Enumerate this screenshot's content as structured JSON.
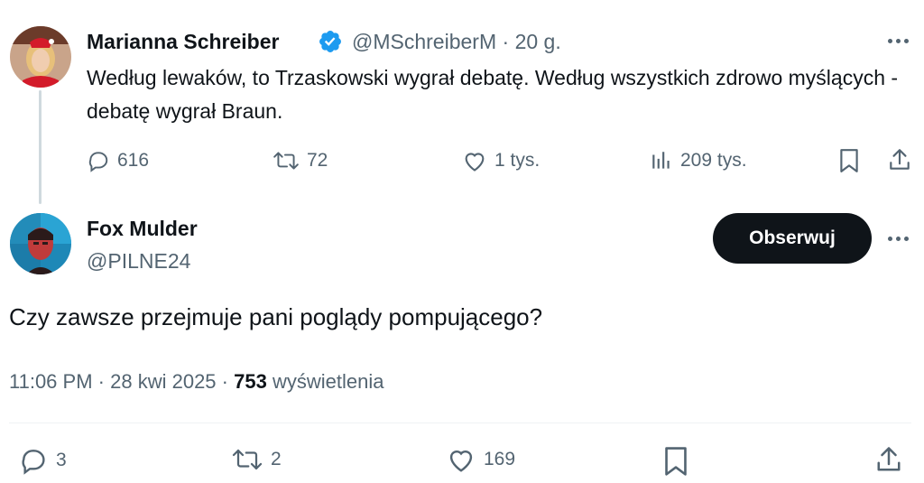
{
  "parent_tweet": {
    "author_name": "Marianna Schreiber",
    "verified": true,
    "handle": "@MSchreiberM",
    "separator": "·",
    "time": "20 g.",
    "text": "Według lewaków, to Trzaskowski wygrał debatę. Według wszystkich zdrowo myślących - debatę wygrał Braun.",
    "replies": "616",
    "retweets": "72",
    "likes": "1 tys.",
    "views": "209 tys."
  },
  "reply_tweet": {
    "author_name": "Fox Mulder",
    "handle": "@PILNE24",
    "follow_label": "Obserwuj",
    "text": "Czy zawsze przejmuje pani poglądy pompującego?",
    "time": "11:06 PM",
    "separator": "·",
    "date": "28 kwi 2025",
    "views_count": "753",
    "views_label": "wyświetlenia",
    "replies": "3",
    "retweets": "2",
    "likes": "169"
  },
  "colors": {
    "text": "#0f1419",
    "muted": "#536471",
    "verified": "#1d9bf0",
    "button": "#0f1419"
  }
}
